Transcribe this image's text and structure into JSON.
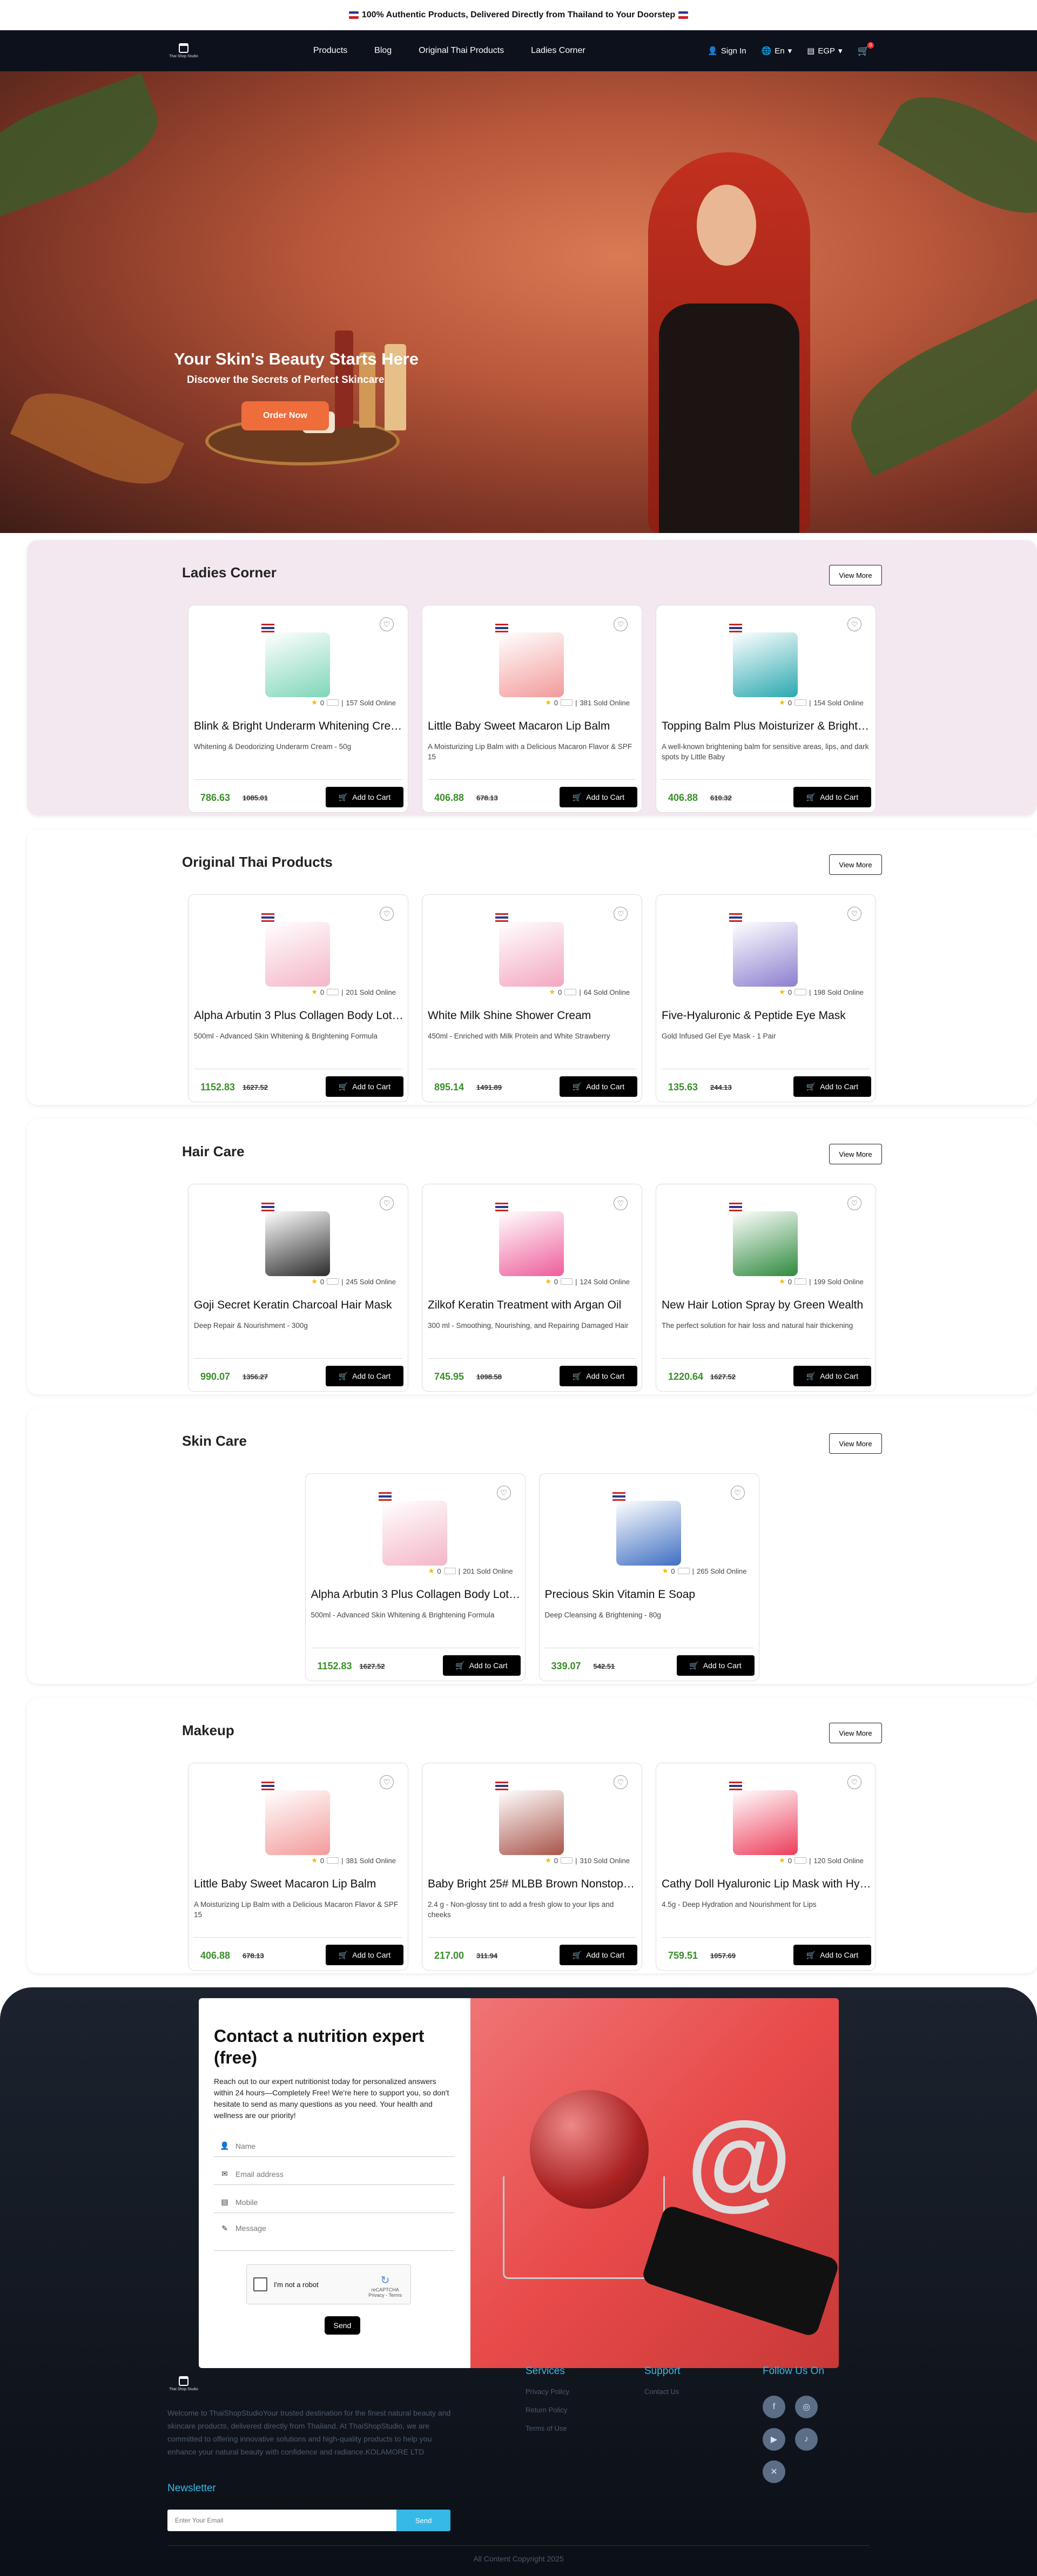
{
  "announcement": {
    "text": "100% Authentic Products, Delivered Directly from Thailand to Your Doorstep"
  },
  "nav": {
    "logo_text": "Thai Shop Studio",
    "links": [
      "Products",
      "Blog",
      "Original Thai Products",
      "Ladies Corner"
    ],
    "sign_in": "Sign In",
    "language": "En",
    "currency": "EGP",
    "cart_count": "0"
  },
  "hero": {
    "title": "Your Skin's Beauty Starts Here",
    "subtitle": "Discover the Secrets of Perfect Skincare",
    "cta": "Order Now"
  },
  "view_more_label": "View More",
  "add_to_cart_label": "Add to Cart",
  "sections": [
    {
      "title": "Ladies Corner",
      "products": [
        {
          "name": "Blink & Bright Underarm Whitening Cream",
          "desc": "Whitening & Deodorizing Underarm Cream - 50g",
          "rating": "0",
          "sold": "157 Sold Online",
          "price": "786.63",
          "old_price": "1085.01",
          "color": "#7fd6b8"
        },
        {
          "name": "Little Baby Sweet Macaron Lip Balm",
          "desc": "A Moisturizing Lip Balm with a Delicious Macaron Flavor & SPF 15",
          "rating": "0",
          "sold": "381 Sold Online",
          "price": "406.88",
          "old_price": "678.13",
          "color": "#f39a9a"
        },
        {
          "name": "Topping Balm Plus Moisturizer & Brightener",
          "desc": "A well-known brightening balm for sensitive areas, lips, and dark spots by Little Baby",
          "rating": "0",
          "sold": "154 Sold Online",
          "price": "406.88",
          "old_price": "610.32",
          "color": "#2aa9b0"
        }
      ]
    },
    {
      "title": "Original Thai Products",
      "products": [
        {
          "name": "Alpha Arbutin 3 Plus Collagen Body Lotion",
          "desc": "500ml - Advanced Skin Whitening & Brightening Formula",
          "rating": "0",
          "sold": "201 Sold Online",
          "price": "1152.83",
          "old_price": "1627.52",
          "color": "#f4b6c8"
        },
        {
          "name": "White Milk Shine Shower Cream",
          "desc": "450ml - Enriched with Milk Protein and White Strawberry",
          "rating": "0",
          "sold": "64 Sold Online",
          "price": "895.14",
          "old_price": "1491.89",
          "color": "#f3a7c0"
        },
        {
          "name": "Five-Hyaluronic & Peptide Eye Mask",
          "desc": "Gold Infused Gel Eye Mask - 1 Pair",
          "rating": "0",
          "sold": "198 Sold Online",
          "price": "135.63",
          "old_price": "244.13",
          "color": "#8d7fd0"
        }
      ]
    },
    {
      "title": "Hair Care",
      "products": [
        {
          "name": "Goji Secret Keratin Charcoal Hair Mask",
          "desc": "Deep Repair & Nourishment - 300g",
          "rating": "0",
          "sold": "245 Sold Online",
          "price": "990.07",
          "old_price": "1356.27",
          "color": "#2b2b2b"
        },
        {
          "name": "Zilkof Keratin Treatment with Argan Oil",
          "desc": "300 ml - Smoothing, Nourishing, and Repairing Damaged Hair",
          "rating": "0",
          "sold": "124 Sold Online",
          "price": "745.95",
          "old_price": "1098.58",
          "color": "#ee5d9b"
        },
        {
          "name": "New Hair Lotion Spray by Green Wealth",
          "desc": "The perfect solution for hair loss and natural hair thickening",
          "rating": "0",
          "sold": "199 Sold Online",
          "price": "1220.64",
          "old_price": "1627.52",
          "color": "#2f8a3e"
        }
      ]
    },
    {
      "title": "Skin Care",
      "products": [
        {
          "name": "Alpha Arbutin 3 Plus Collagen Body Lotion",
          "desc": "500ml - Advanced Skin Whitening & Brightening Formula",
          "rating": "0",
          "sold": "201 Sold Online",
          "price": "1152.83",
          "old_price": "1627.52",
          "color": "#f4b6c8"
        },
        {
          "name": "Precious Skin Vitamin E Soap",
          "desc": "Deep Cleansing & Brightening - 80g",
          "rating": "0",
          "sold": "265 Sold Online",
          "price": "339.07",
          "old_price": "542.51",
          "color": "#3f6fc2"
        }
      ]
    },
    {
      "title": "Makeup",
      "products": [
        {
          "name": "Little Baby Sweet Macaron Lip Balm",
          "desc": "A Moisturizing Lip Balm with a Delicious Macaron Flavor & SPF 15",
          "rating": "0",
          "sold": "381 Sold Online",
          "price": "406.88",
          "old_price": "678.13",
          "color": "#f39a9a"
        },
        {
          "name": "Baby Bright 25# MLBB Brown Nonstop Lip & Cheek",
          "desc": "2.4 g - Non-glossy tint to add a fresh glow to your lips and cheeks",
          "rating": "0",
          "sold": "310 Sold Online",
          "price": "217.00",
          "old_price": "311.94",
          "color": "#a9544a"
        },
        {
          "name": "Cathy Doll Hyaluronic Lip Mask with Hyaluronic Acid",
          "desc": "4.5g - Deep Hydration and Nourishment for Lips",
          "rating": "0",
          "sold": "120 Sold Online",
          "price": "759.51",
          "old_price": "1057.69",
          "color": "#ec3d5a"
        }
      ]
    }
  ],
  "contact": {
    "title": "Contact a nutrition expert (free)",
    "text": "Reach out to our expert nutritionist today for personalized answers within 24 hours—Completely Free! We're here to support you, so don't hesitate to send as many questions as you need. Your health and wellness are our priority!",
    "name_placeholder": "Name",
    "email_placeholder": "Email address",
    "mobile_placeholder": "Mobile",
    "message_placeholder": "Message",
    "captcha_label": "I'm not a robot",
    "captcha_brand": "reCAPTCHA",
    "captcha_terms": "Privacy - Terms",
    "send": "Send"
  },
  "footer": {
    "about": "Welcome to ThaiShopStudioYour trusted destination for the finest natural beauty and skincare products, delivered directly from Thailand. At ThaiShopStudio, we are committed to offering innovative solutions and high-quality products to help you enhance your natural beauty with confidence and radiance.KOLAMORE LTD",
    "services_title": "Services",
    "services": [
      "Privacy Policy",
      "Return Policy",
      "Terms of Use"
    ],
    "support_title": "Support",
    "support": [
      "Contact Us"
    ],
    "follow_title": "Follow Us On",
    "newsletter_title": "Newsletter",
    "newsletter_placeholder": "Enter Your Email",
    "newsletter_button": "Send",
    "copyright": "All Content Copyright 2025"
  }
}
